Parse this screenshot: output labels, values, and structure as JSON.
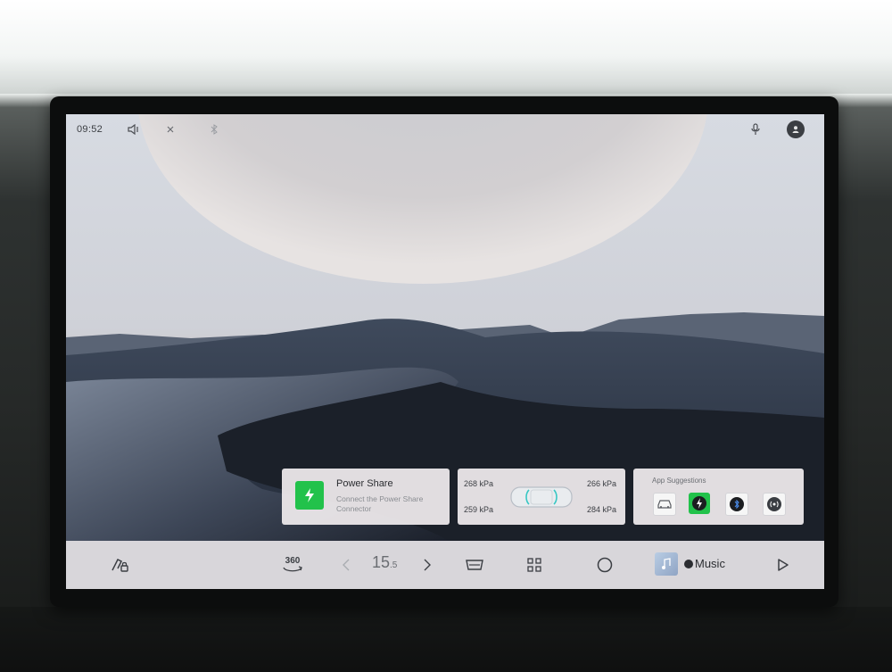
{
  "status_bar": {
    "time": "09:52",
    "icons": [
      "volume-icon",
      "mute-icon",
      "bluetooth-icon",
      "microphone-icon",
      "profile-icon"
    ]
  },
  "power_share": {
    "title": "Power Share",
    "subtitle": "Connect the Power Share Connector",
    "icon": "lightning-icon",
    "accent": "#22c24b"
  },
  "tire_pressure": {
    "front_left": "268 kPa",
    "front_right": "266 kPa",
    "rear_left": "259 kPa",
    "rear_right": "284 kPa"
  },
  "app_suggestions": {
    "title": "App Suggestions",
    "apps": [
      "car-icon",
      "power-share-icon",
      "bluetooth-icon",
      "radio-icon"
    ]
  },
  "dock": {
    "icons": [
      "car-lock-icon",
      "camera-360-icon",
      "chevron-left-icon",
      "chevron-right-icon",
      "seat-icon",
      "apps-grid-icon",
      "home-circle-icon",
      "play-icon"
    ],
    "camera_label": "360",
    "temp_main": "15",
    "temp_decimal": ".5",
    "music_label": "Music"
  }
}
